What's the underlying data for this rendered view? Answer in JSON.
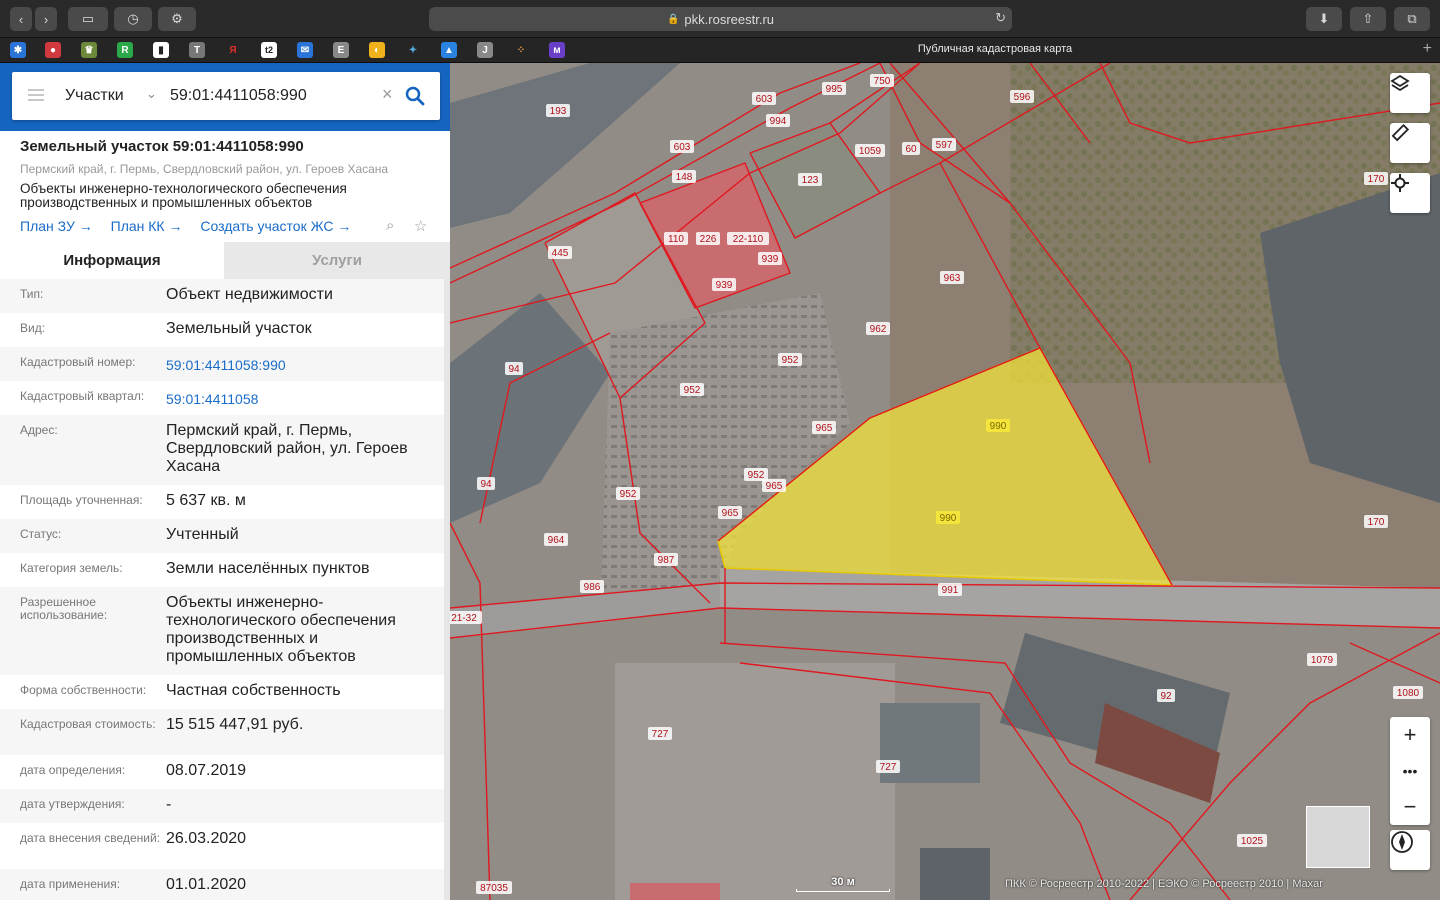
{
  "browser": {
    "url": "pkk.rosreestr.ru",
    "tab_title": "Публичная кадастровая карта"
  },
  "search": {
    "category": "Участки",
    "query": "59:01:4411058:990"
  },
  "object": {
    "title": "Земельный участок 59:01:4411058:990",
    "address": "Пермский край, г. Пермь, Свердловский район, ул. Героев Хасана",
    "description": "Объекты инженерно-технологического обеспечения производственных и промышленных объектов",
    "links": [
      "План ЗУ →",
      "План КК →",
      "Создать участок ЖС →"
    ]
  },
  "tabs": [
    "Информация",
    "Услуги"
  ],
  "info": [
    {
      "key": "Тип:",
      "value": "Объект недвижимости"
    },
    {
      "key": "Вид:",
      "value": "Земельный участок"
    },
    {
      "key": "Кадастровый номер:",
      "value": "59:01:4411058:990",
      "link": true
    },
    {
      "key": "Кадастровый квартал:",
      "value": "59:01:4411058",
      "link": true
    },
    {
      "key": "Адрес:",
      "value": "Пермский край, г. Пермь, Свердловский район, ул. Героев Хасана"
    },
    {
      "key": "Площадь уточненная:",
      "value": "5 637 кв. м"
    },
    {
      "key": "Статус:",
      "value": "Учтенный"
    },
    {
      "key": "Категория земель:",
      "value": "Земли населённых пунктов"
    },
    {
      "key": "Разрешенное использование:",
      "value": "Объекты инженерно-технологического обеспечения производственных и промышленных объектов"
    },
    {
      "key": "Форма собственности:",
      "value": "Частная собственность"
    },
    {
      "key": "Кадастровая стоимость:",
      "value": "15 515 447,91 руб."
    },
    {
      "key": "дата определения:",
      "value": "08.07.2019"
    },
    {
      "key": "дата утверждения:",
      "value": "-"
    },
    {
      "key": "дата внесения сведений:",
      "value": "26.03.2020"
    },
    {
      "key": "дата применения:",
      "value": "01.01.2020"
    }
  ],
  "map": {
    "scale_label": "30 м",
    "copyright": "ПКК © Росреестр 2010-2022 | ЕЭКО © Росреестр 2010 | Maxar",
    "highlight_color": "#f5e63a",
    "parcel_labels": [
      "193",
      "603",
      "995",
      "750",
      "596",
      "994",
      "603",
      "1059",
      "60",
      "597",
      "123",
      "148",
      "110",
      "226",
      "22-110",
      "939",
      "445",
      "963",
      "170",
      "939",
      "962",
      "94",
      "952",
      "952",
      "990",
      "990",
      "965",
      "952",
      "94",
      "965",
      "952",
      "965",
      "170",
      "964",
      "987",
      "986",
      "991",
      "21-32",
      "1079",
      "92",
      "1080",
      "727",
      "727",
      "1025",
      "87035"
    ]
  }
}
